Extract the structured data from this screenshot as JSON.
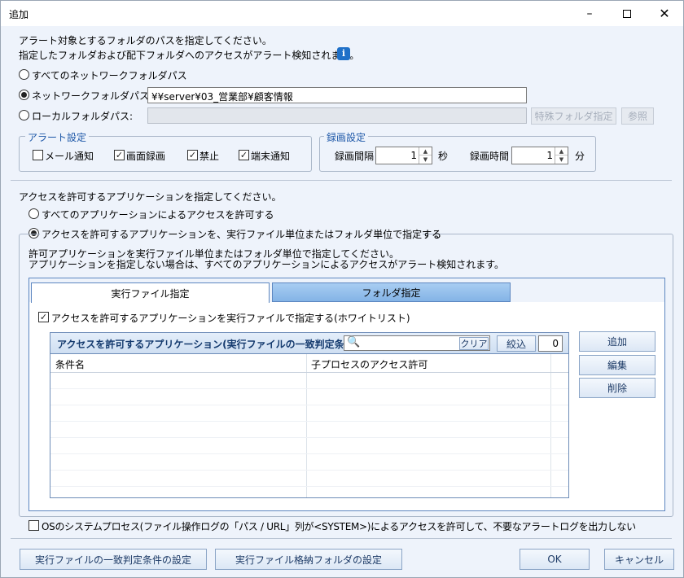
{
  "window": {
    "title": "追加"
  },
  "target": {
    "line1": "アラート対象とするフォルダのパスを指定してください。",
    "line2": "指定したフォルダおよび配下フォルダへのアクセスがアラート検知されます。",
    "radio_all": "すべてのネットワークフォルダパス",
    "radio_network": "ネットワークフォルダパス:",
    "network_path": "¥¥server¥03_営業部¥顧客情報",
    "radio_local": "ローカルフォルダパス:",
    "local_path": "",
    "special_folder_btn": "特殊フォルダ指定",
    "browse_btn": "参照"
  },
  "alert_settings": {
    "label": "アラート設定",
    "mail": "メール通知",
    "screen": "画面録画",
    "block": "禁止",
    "terminal": "端末通知"
  },
  "recording": {
    "label": "録画設定",
    "interval_label": "録画間隔",
    "interval_value": "1",
    "interval_unit": "秒",
    "time_label": "録画時間",
    "time_value": "1",
    "time_unit": "分"
  },
  "apps": {
    "heading": "アクセスを許可するアプリケーションを指定してください。",
    "radio_all": "すべてのアプリケーションによるアクセスを許可する",
    "radio_specify": "アクセスを許可するアプリケーションを、実行ファイル単位またはフォルダ単位で指定する",
    "desc1": "許可アプリケーションを実行ファイル単位またはフォルダ単位で指定してください。",
    "desc2": "アプリケーションを指定しない場合は、すべてのアプリケーションによるアクセスがアラート検知されます。",
    "tabs": [
      "実行ファイル指定",
      "フォルダ指定"
    ],
    "whitelist_label": "アクセスを許可するアプリケーションを実行ファイルで指定する(ホワイトリスト)",
    "table_title": "アクセスを許可するアプリケーション(実行ファイルの一致判定条件)",
    "search_placeholder": "",
    "clear_btn": "クリア",
    "filter_btn": "絞込",
    "count": "0",
    "columns": [
      "条件名",
      "子プロセスのアクセス許可"
    ],
    "add_btn": "追加",
    "edit_btn": "編集",
    "delete_btn": "削除"
  },
  "system_process_label": "OSのシステムプロセス(ファイル操作ログの「パス / URL」列が<SYSTEM>)によるアクセスを許可して、不要なアラートログを出力しない",
  "footer": {
    "match_btn": "実行ファイルの一致判定条件の設定",
    "folder_btn": "実行ファイル格納フォルダの設定",
    "ok_btn": "OK",
    "cancel_btn": "キャンセル"
  }
}
